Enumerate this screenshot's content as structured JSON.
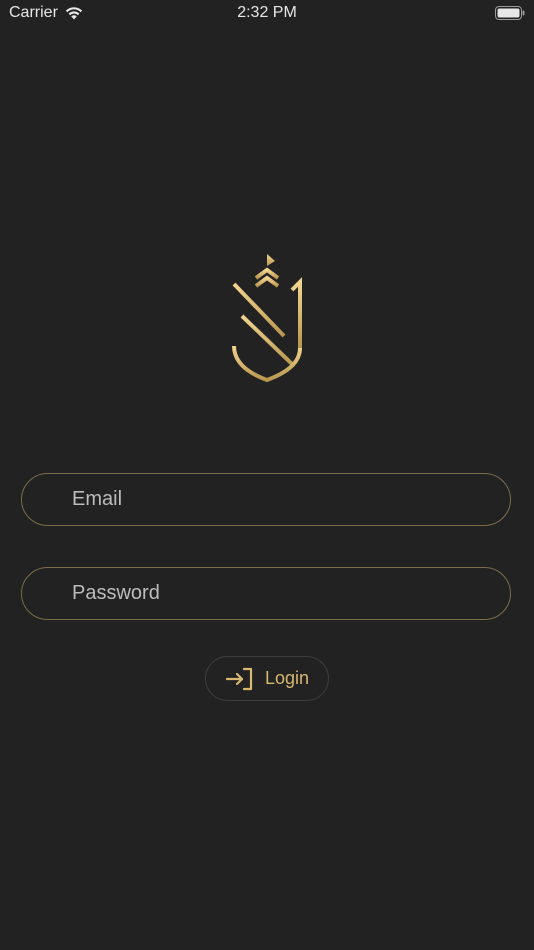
{
  "status_bar": {
    "carrier": "Carrier",
    "time": "2:32 PM"
  },
  "logo": {
    "icon": "brand-shield-logo",
    "color": "#d8b771"
  },
  "login_form": {
    "email_placeholder": "Email",
    "password_placeholder": "Password",
    "login_label": "Login",
    "login_icon": "sign-in-icon"
  },
  "colors": {
    "background": "#222222",
    "accent_gold": "#d8b771",
    "field_border": "#7d6c4a"
  }
}
